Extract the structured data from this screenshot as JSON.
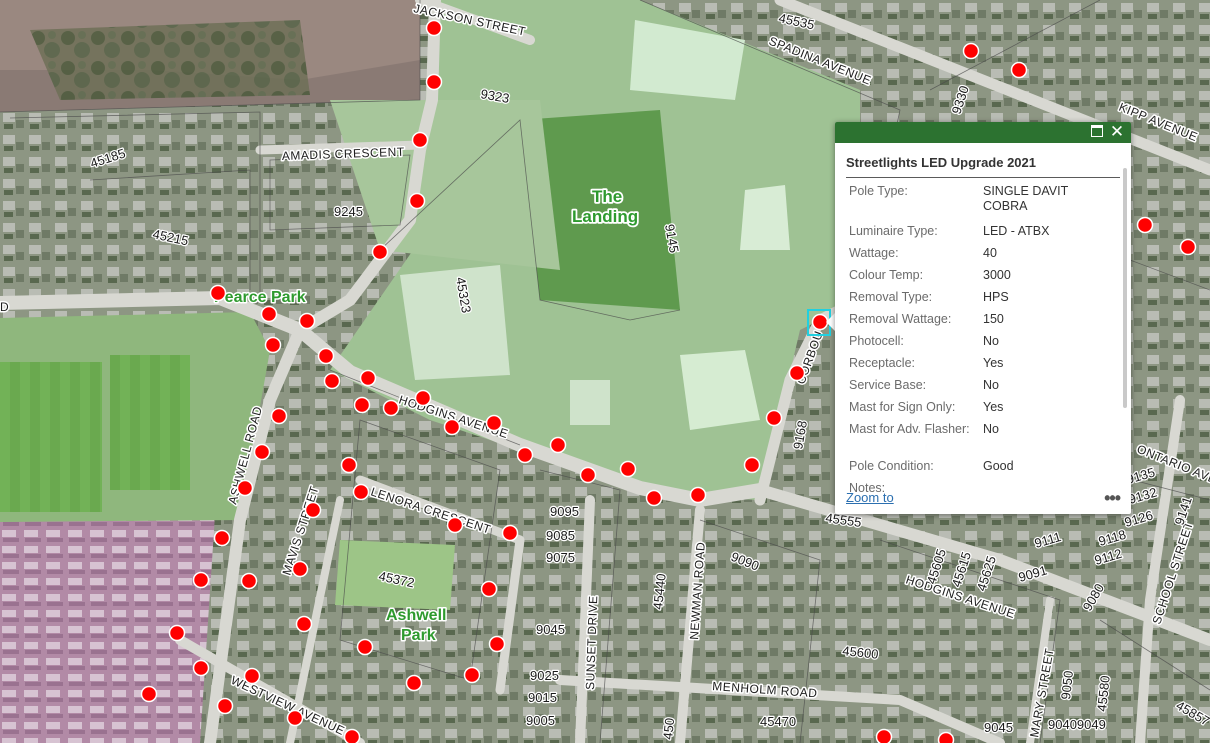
{
  "map": {
    "streets": {
      "jackson": "JACKSON STREET",
      "spadina": "SPADINA AVENUE",
      "kipp": "KIPP AVENUE",
      "amadis": "AMADIS CRESCENT",
      "hodgins_w": "HODGINS AVENUE",
      "hodgins_e": "HODGINS AVENUE",
      "ashwell": "ASHWELL ROAD",
      "mavis": "MAVIS STREET",
      "lenora": "LENORA CRESCENT",
      "sunset": "SUNSET DRIVE",
      "newman": "NEWMAN ROAD",
      "menholm": "MENHOLM ROAD",
      "westview": "WESTVIEW AVENUE",
      "corbould": "CORBOU",
      "ontario": "ONTARIO AVEN",
      "school": "SCHOOL STREET",
      "mary": "MARY STREET"
    },
    "parks": {
      "the_landing_1": "The",
      "the_landing_2": "Landing",
      "pearce_park": "Pearce Park",
      "ashwell_park_1": "Ashwell",
      "ashwell_park_2": "Park"
    },
    "lots": {
      "l45185": "45185",
      "l45215": "45215",
      "l9245": "9245",
      "l9323": "9323",
      "l45323": "45323",
      "l9145": "9145",
      "l45535": "45535",
      "l9330": "9330",
      "l9168": "9168",
      "l45372": "45372",
      "l9095": "9095",
      "l9085": "9085",
      "l9075": "9075",
      "l9045a": "9045",
      "l9025": "9025",
      "l9015": "9015",
      "l9005": "9005",
      "l45440": "45440",
      "l9090": "9090",
      "l45600": "45600",
      "l45470": "45470",
      "l45555": "45555",
      "l45605": "45605",
      "l45615": "45615",
      "l45625": "45625",
      "l9111": "9111",
      "l9091": "9091",
      "l9080": "9080",
      "l9132": "9132",
      "l9126": "9126",
      "l9118": "9118",
      "l9112": "9112",
      "l9141": "9141",
      "l9050": "9050",
      "l45580": "45580",
      "l9045b": "9045",
      "l90409049": "90409049",
      "l45857": "45857",
      "l9135": "9135",
      "l450": "450",
      "lD": "D"
    }
  },
  "popup": {
    "title": "Streetlights LED Upgrade 2021",
    "zoom_to": "Zoom to",
    "more": "•••",
    "close": "✕",
    "attributes": [
      {
        "label": "Pole Type:",
        "value": "SINGLE DAVIT COBRA"
      },
      {
        "label": "Luminaire Type:",
        "value": "LED - ATBX"
      },
      {
        "label": "Wattage:",
        "value": "40"
      },
      {
        "label": "Colour Temp:",
        "value": "3000"
      },
      {
        "label": "Removal Type:",
        "value": "HPS"
      },
      {
        "label": "Removal Wattage:",
        "value": "150"
      },
      {
        "label": "Photocell:",
        "value": "No"
      },
      {
        "label": "Receptacle:",
        "value": "Yes"
      },
      {
        "label": "Service Base:",
        "value": "No"
      },
      {
        "label": "Mast for Sign Only:",
        "value": "Yes"
      },
      {
        "label": "Mast for Adv. Flasher:",
        "value": "No"
      },
      {
        "label": "Pole Condition:",
        "value": "Good"
      },
      {
        "label": "Notes:",
        "value": ""
      }
    ]
  },
  "colors": {
    "streetlight": "#ff0000",
    "popup_header": "#2c7230",
    "park_label": "#2e9a2e",
    "selection": "#20d0e0"
  }
}
